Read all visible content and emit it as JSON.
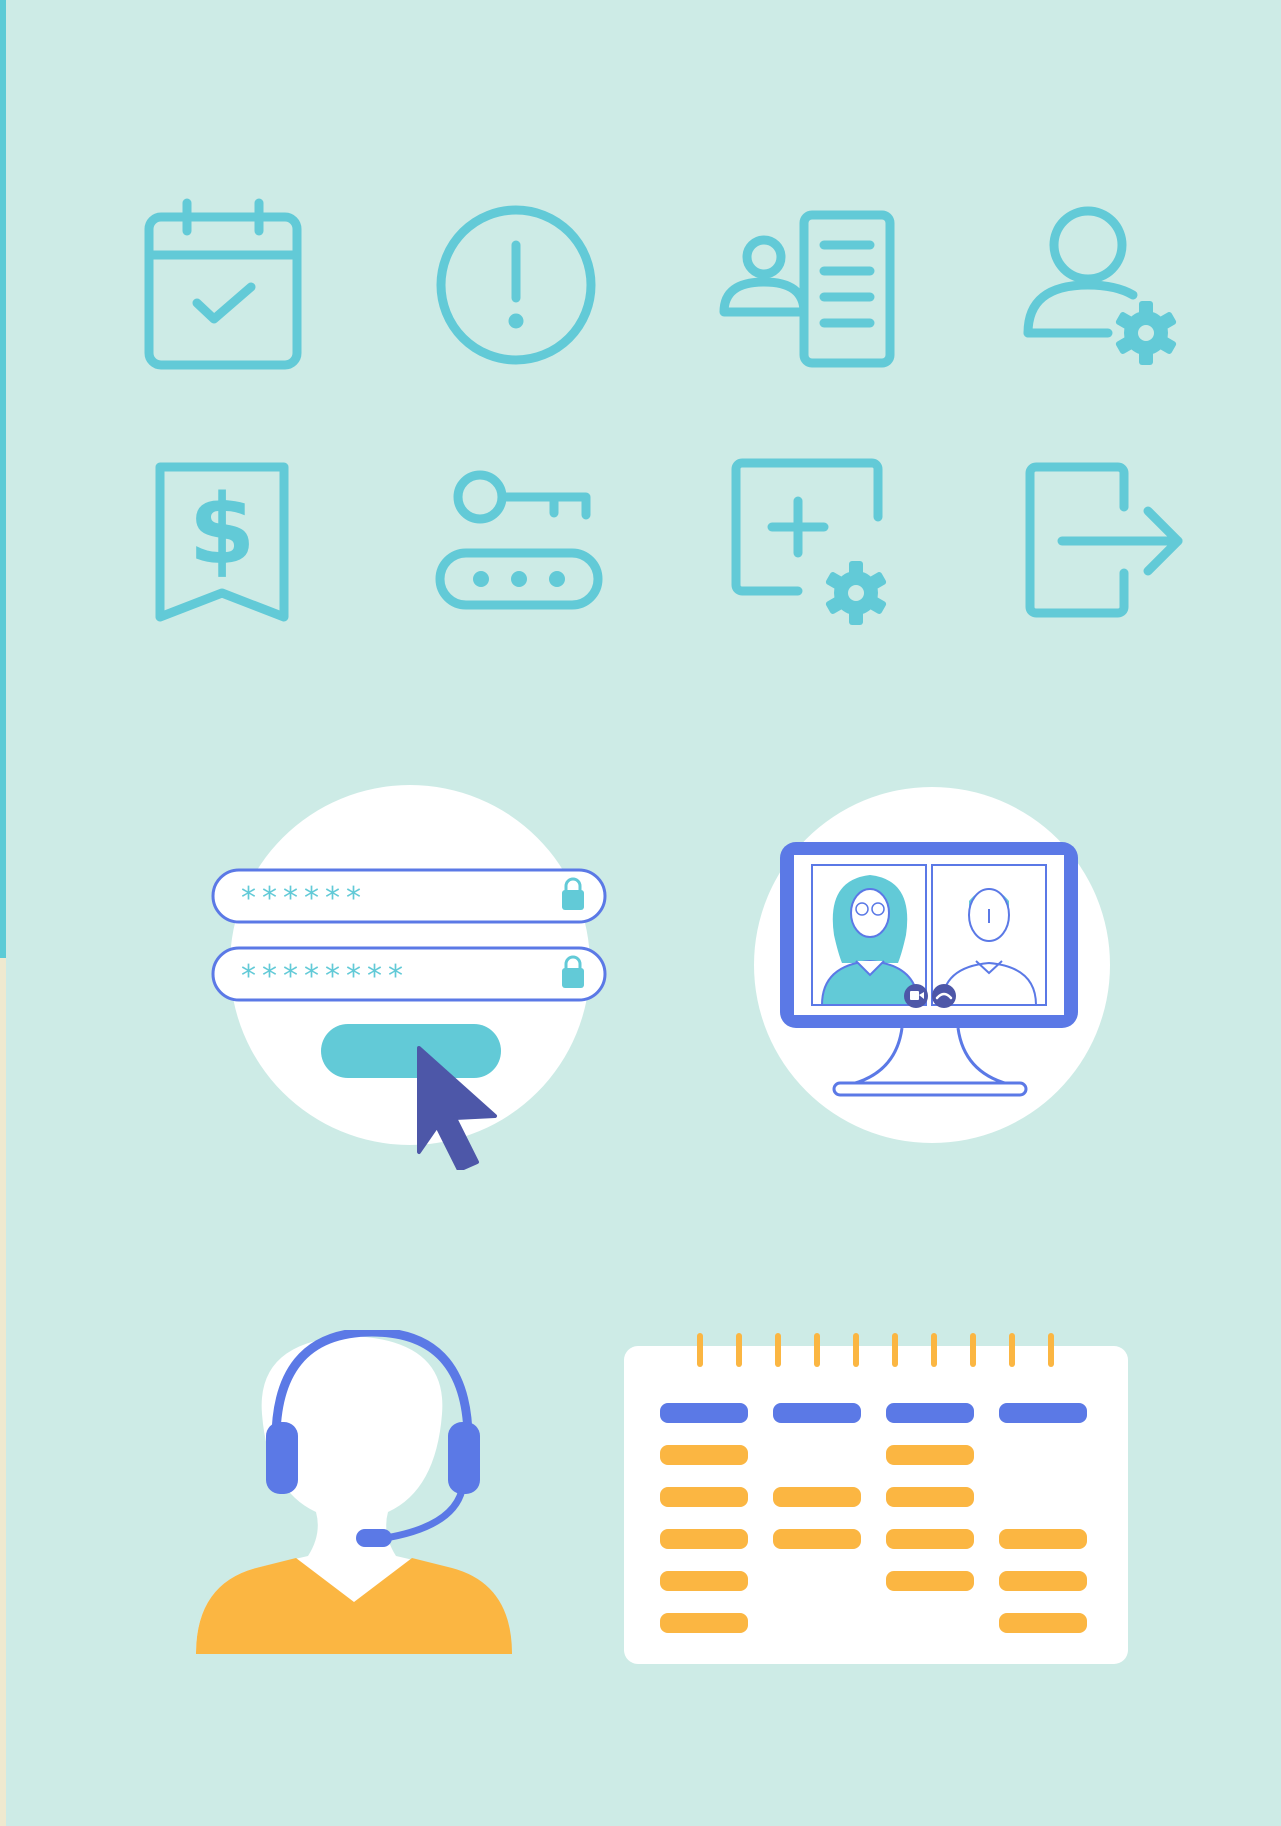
{
  "colors": {
    "background": "#cdebe6",
    "icon_stroke": "#62cad7",
    "accent_blue": "#5b79e6",
    "cursor": "#4d57a8",
    "orange": "#fbb642",
    "white": "#ffffff",
    "edge_teal": "#5ccbd6",
    "edge_cream": "#efe9cf"
  },
  "icons": [
    {
      "name": "calendar-check-icon"
    },
    {
      "name": "alert-circle-icon"
    },
    {
      "name": "user-document-icon"
    },
    {
      "name": "user-settings-icon"
    },
    {
      "name": "dollar-bookmark-icon"
    },
    {
      "name": "key-password-icon"
    },
    {
      "name": "add-settings-icon"
    },
    {
      "name": "logout-icon"
    }
  ],
  "login": {
    "password_field_1": "******",
    "password_field_2": "********"
  }
}
